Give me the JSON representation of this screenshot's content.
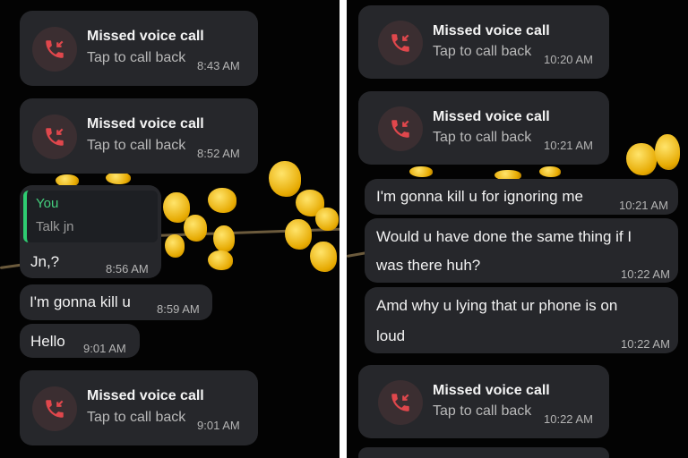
{
  "left": {
    "messages": [
      {
        "type": "call",
        "title": "Missed voice call",
        "subtitle": "Tap to call back",
        "time": "8:43 AM"
      },
      {
        "type": "call",
        "title": "Missed voice call",
        "subtitle": "Tap to call back",
        "time": "8:52 AM"
      },
      {
        "type": "reply",
        "quote_author": "You",
        "quote_text": "Talk jn",
        "text": "Jn,?",
        "time": "8:56 AM"
      },
      {
        "type": "text",
        "text": "I'm gonna kill u",
        "time": "8:59 AM"
      },
      {
        "type": "text",
        "text": "Hello",
        "time": "9:01 AM"
      },
      {
        "type": "call",
        "title": "Missed voice call",
        "subtitle": "Tap to call back",
        "time": "9:01 AM"
      }
    ]
  },
  "right": {
    "messages": [
      {
        "type": "call",
        "title": "Missed voice call",
        "subtitle": "Tap to call back",
        "time": "10:20 AM"
      },
      {
        "type": "call",
        "title": "Missed voice call",
        "subtitle": "Tap to call back",
        "time": "10:21 AM"
      },
      {
        "type": "text",
        "text": "I'm gonna kill u for ignoring me",
        "time": "10:21 AM"
      },
      {
        "type": "text2",
        "line1": "Would u have done the same thing if I",
        "line2": "was there huh?",
        "time": "10:22 AM"
      },
      {
        "type": "text2",
        "line1": "Amd why u lying that ur phone is on",
        "line2": "loud",
        "time": "10:22 AM"
      },
      {
        "type": "call",
        "title": "Missed voice call",
        "subtitle": "Tap to call back",
        "time": "10:22 AM"
      }
    ]
  },
  "colors": {
    "bubble": "#26272b",
    "missed_call_red": "#e0474c",
    "quote_bar": "#2ecc71",
    "background": "#030303"
  },
  "icons": {
    "missed_call": "missed-call-icon"
  }
}
